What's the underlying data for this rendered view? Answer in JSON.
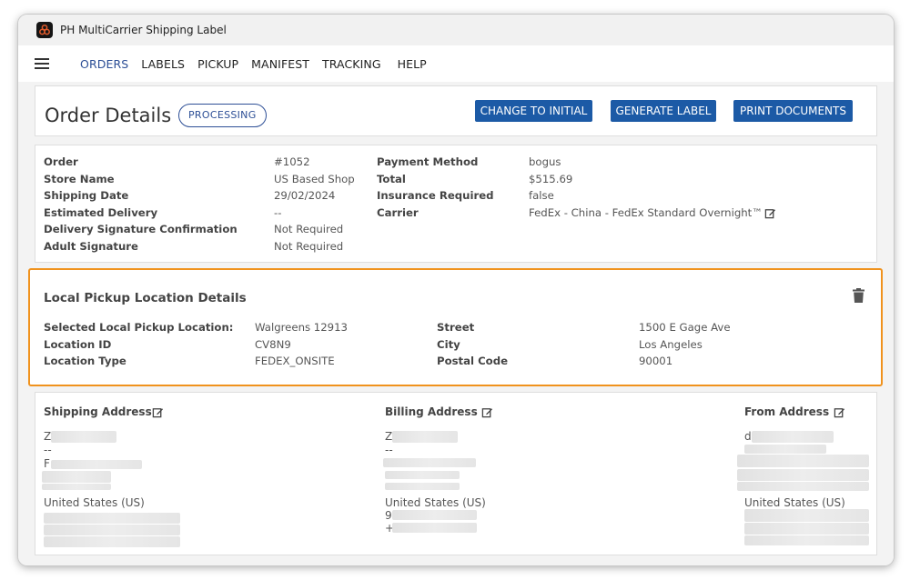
{
  "app": {
    "title": "PH MultiCarrier Shipping Label"
  },
  "nav": {
    "items": [
      "ORDERS",
      "LABELS",
      "PICKUP",
      "MANIFEST",
      "TRACKING",
      "HELP"
    ]
  },
  "header": {
    "title": "Order Details",
    "status": "PROCESSING",
    "buttons": [
      "CHANGE TO INITIAL",
      "GENERATE LABEL",
      "PRINT DOCUMENTS"
    ]
  },
  "order": {
    "left": [
      {
        "label": "Order",
        "value": "#1052"
      },
      {
        "label": "Store Name",
        "value": "US Based Shop"
      },
      {
        "label": "Shipping Date",
        "value": "29/02/2024"
      },
      {
        "label": "Estimated Delivery",
        "value": "--"
      },
      {
        "label": "Delivery Signature Confirmation",
        "value": "Not Required"
      },
      {
        "label": "Adult Signature",
        "value": "Not Required"
      }
    ],
    "right": [
      {
        "label": "Payment Method",
        "value": "bogus"
      },
      {
        "label": "Total",
        "value": "$515.69"
      },
      {
        "label": "Insurance Required",
        "value": "false"
      },
      {
        "label": "Carrier",
        "value": "FedEx - China - FedEx Standard Overnight™"
      }
    ]
  },
  "pickup": {
    "title": "Local Pickup Location Details",
    "left": [
      {
        "label": "Selected Local Pickup Location:",
        "value": "Walgreens 12913"
      },
      {
        "label": "Location ID",
        "value": "CV8N9"
      },
      {
        "label": "Location Type",
        "value": "FEDEX_ONSITE"
      }
    ],
    "right": [
      {
        "label": "Street",
        "value": "1500 E Gage Ave"
      },
      {
        "label": "City",
        "value": "Los Angeles"
      },
      {
        "label": "Postal Code",
        "value": "90001"
      }
    ]
  },
  "addresses": {
    "shipping": {
      "title": "Shipping Address",
      "lines": [
        "Z",
        "--",
        "F"
      ],
      "country": "United States (US)"
    },
    "billing": {
      "title": "Billing Address",
      "lines": [
        "Z",
        "--"
      ],
      "country": "United States (US)",
      "extra": [
        "9",
        "+"
      ]
    },
    "from": {
      "title": "From Address",
      "lines": [
        "d"
      ],
      "country": "United States (US)"
    }
  },
  "colors": {
    "accent": "#2d4f96",
    "button": "#1c5aa6",
    "highlight": "#f0921d"
  }
}
